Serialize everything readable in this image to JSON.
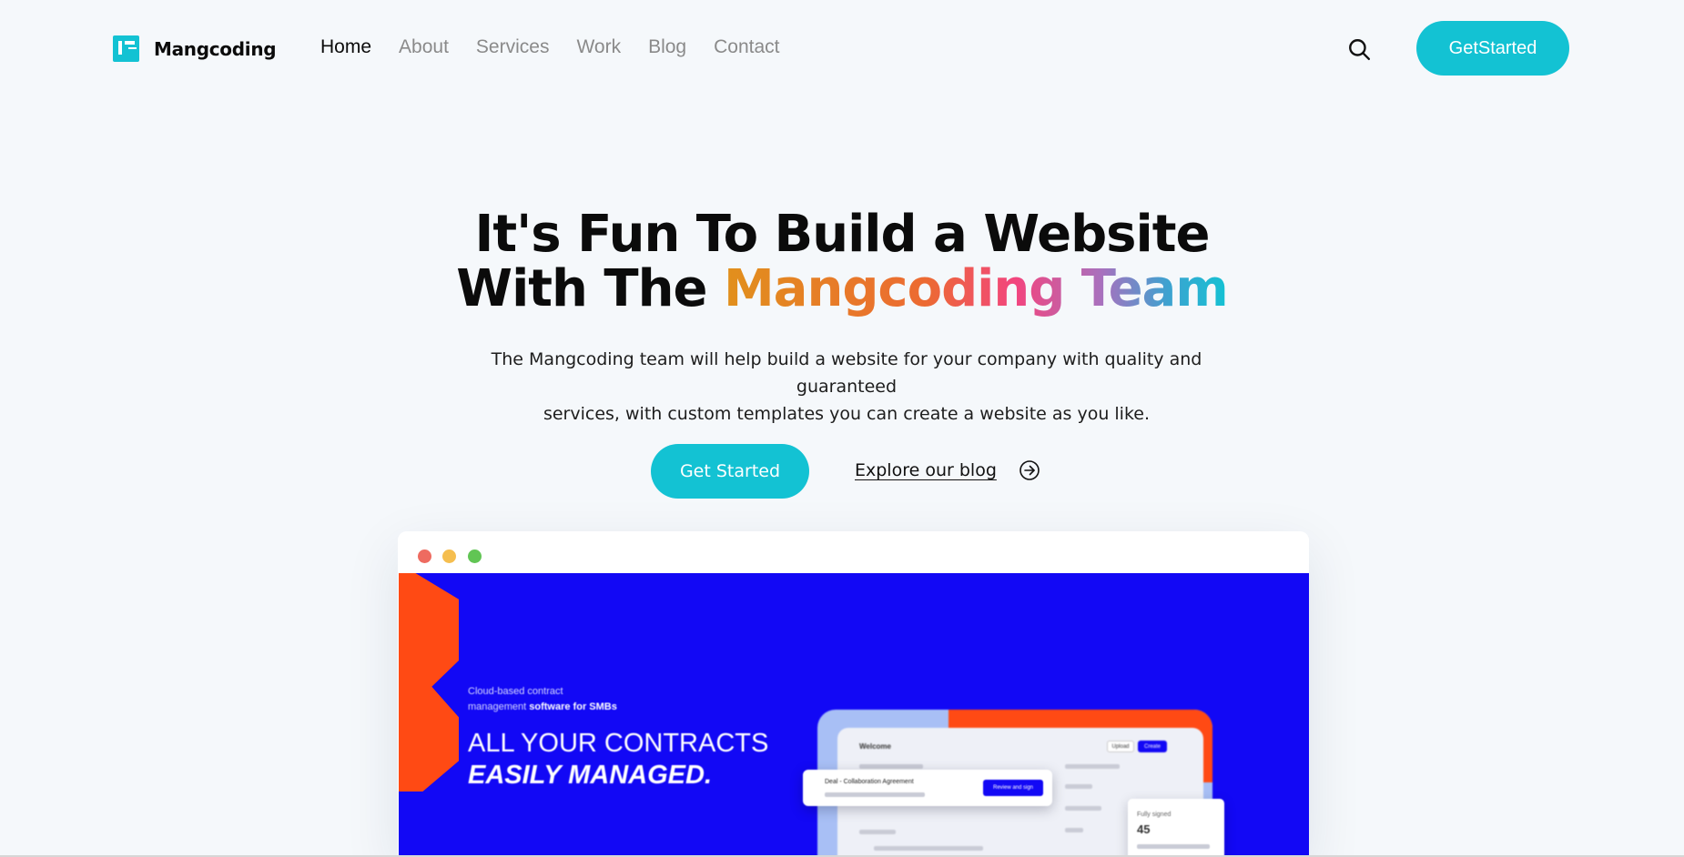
{
  "brand": {
    "name": "Mangcoding",
    "accent": "#13c2d3"
  },
  "nav": {
    "items": [
      {
        "label": "Home",
        "active": true
      },
      {
        "label": "About",
        "active": false
      },
      {
        "label": "Services",
        "active": false
      },
      {
        "label": "Work",
        "active": false
      },
      {
        "label": "Blog",
        "active": false
      },
      {
        "label": "Contact",
        "active": false
      }
    ],
    "search_icon": "search-icon",
    "cta_label": "GetStarted"
  },
  "hero": {
    "title_line1": "It's Fun To Build a Website",
    "title_line2_prefix": "With The ",
    "title_line2_highlight": "Mangcoding Team",
    "subtitle_line1": "The Mangcoding team will help build a website for your company with quality and guaranteed",
    "subtitle_line2": "services, with custom templates you can create a website as you like.",
    "primary_button": "Get Started",
    "secondary_link": "Explore our blog",
    "secondary_icon": "arrow-right-circle-icon"
  },
  "preview": {
    "window_dots": [
      "#ee6b60",
      "#f5be4f",
      "#61c554"
    ],
    "background": "#1208f5",
    "tagline_line1": "Cloud-based contract",
    "tagline_line2_prefix": "management ",
    "tagline_line2_bold": "software for SMBs",
    "headline_line1": "ALL YOUR CONTRACTS",
    "headline_line2": "EASILY MANAGED.",
    "dashboard": {
      "title": "Welcome",
      "upload_label": "Upload",
      "create_label": "Create",
      "card_title": "Deal - Collaboration Agreement",
      "card_button": "Review and sign",
      "signed_label": "Fully signed",
      "signed_value": "45"
    }
  }
}
